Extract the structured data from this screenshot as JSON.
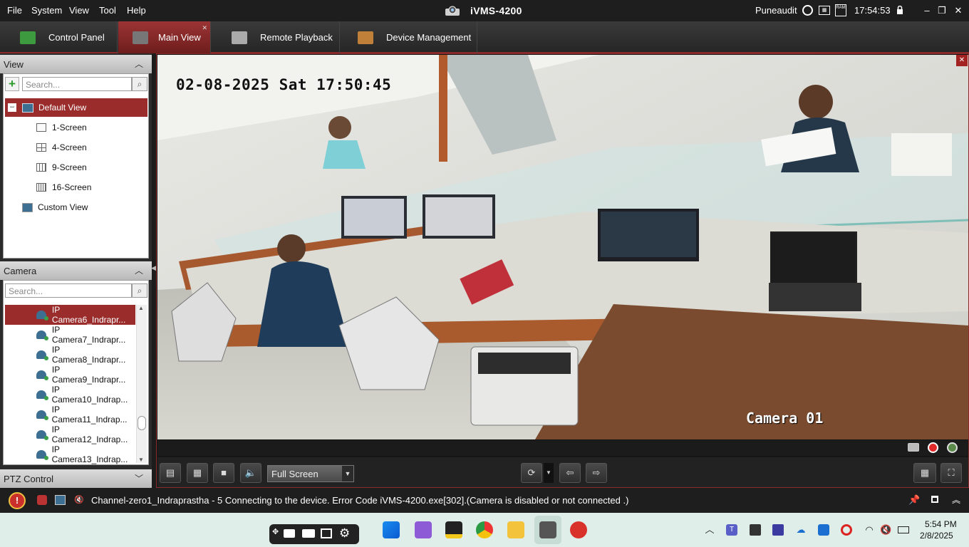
{
  "titlebar": {
    "menu": [
      "File",
      "System",
      "View",
      "Tool",
      "Help"
    ],
    "app_title": "iVMS-4200",
    "user": "Puneaudit",
    "time": "17:54:53"
  },
  "tabs": [
    {
      "label": "Control Panel",
      "icon": "control-panel-icon"
    },
    {
      "label": "Main View",
      "icon": "main-view-icon"
    },
    {
      "label": "Remote Playback",
      "icon": "remote-playback-icon"
    },
    {
      "label": "Device Management",
      "icon": "device-management-icon"
    }
  ],
  "view_panel": {
    "title": "View",
    "search_placeholder": "Search...",
    "items": [
      "Default View",
      "1-Screen",
      "4-Screen",
      "9-Screen",
      "16-Screen",
      "Custom View"
    ]
  },
  "camera_panel": {
    "title": "Camera",
    "search_placeholder": "Search...",
    "cameras": [
      "IP Camera6_Indrapr...",
      "IP Camera7_Indrapr...",
      "IP Camera8_Indrapr...",
      "IP Camera9_Indrapr...",
      "IP Camera10_Indrap...",
      "IP Camera11_Indrap...",
      "IP Camera12_Indrap...",
      "IP Camera13_Indrap..."
    ]
  },
  "ptz_panel": {
    "title": "PTZ Control"
  },
  "video": {
    "osd_datetime": "02-08-2025 Sat 17:50:45",
    "osd_camera": "Camera 01"
  },
  "controls": {
    "screen_mode": "Full Screen"
  },
  "message": "Channel-zero1_Indraprastha - 5 Connecting to the device. Error Code iVMS-4200.exe[302].(Camera is disabled or not connected .)",
  "taskbar": {
    "clock_time": "5:54 PM",
    "clock_date": "2/8/2025"
  },
  "colors": {
    "accent": "#9a2c2c",
    "titlebar": "#1e1e1e",
    "taskbar": "#dfeee8"
  }
}
